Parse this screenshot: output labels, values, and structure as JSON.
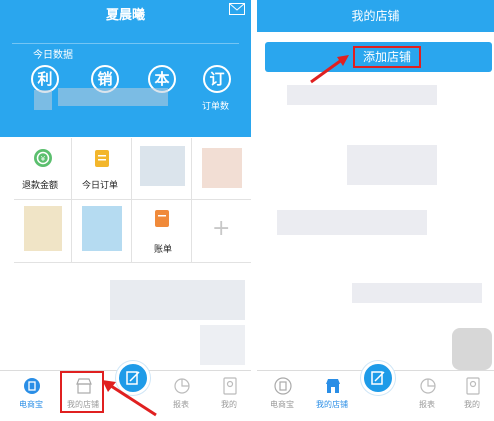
{
  "left_screen": {
    "header_title": "夏晨曦",
    "section_label": "今日数据",
    "stat_circles": [
      "利",
      "销",
      "本",
      "订"
    ],
    "order_count_label": "订单数",
    "grid_labels": [
      "退款金额",
      "今日订单",
      "账单"
    ],
    "tabbar": {
      "items": [
        "电商宝",
        "我的店铺",
        "报表",
        "我的"
      ]
    }
  },
  "right_screen": {
    "header_title": "我的店铺",
    "add_store_button": "添加店铺",
    "tabbar": {
      "items": [
        "电商宝",
        "我的店铺",
        "报表",
        "我的"
      ]
    }
  },
  "colors": {
    "header_blue": "#2aa6ee",
    "active_tab": "#2a8ee6",
    "highlight_red": "#e02020"
  }
}
